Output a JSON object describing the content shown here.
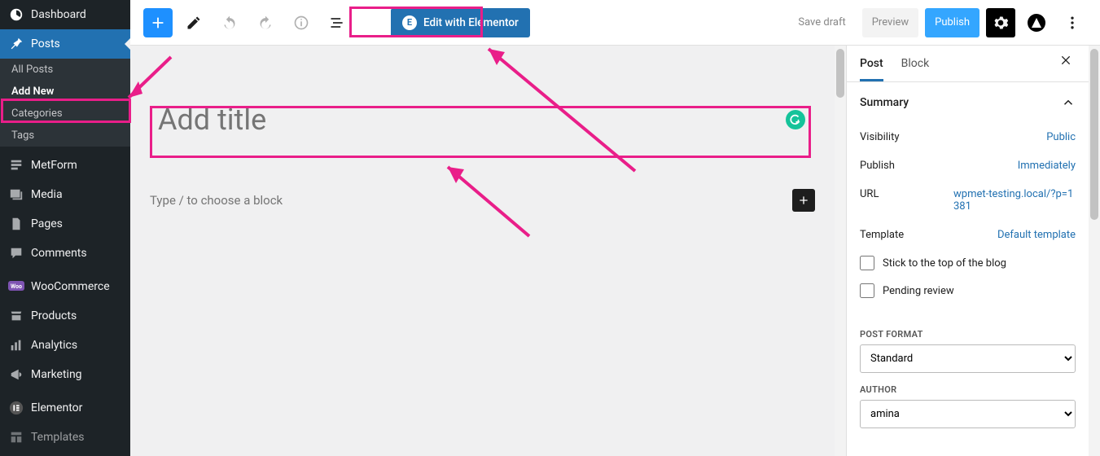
{
  "sidebar": {
    "dashboard": "Dashboard",
    "posts": "Posts",
    "posts_sub": [
      {
        "label": "All Posts"
      },
      {
        "label": "Add New"
      },
      {
        "label": "Categories"
      },
      {
        "label": "Tags"
      }
    ],
    "items": [
      {
        "label": "MetForm"
      },
      {
        "label": "Media"
      },
      {
        "label": "Pages"
      },
      {
        "label": "Comments"
      },
      {
        "label": "WooCommerce"
      },
      {
        "label": "Products"
      },
      {
        "label": "Analytics"
      },
      {
        "label": "Marketing"
      },
      {
        "label": "Elementor"
      },
      {
        "label": "Templates"
      }
    ]
  },
  "topbar": {
    "edit_elementor": "Edit with Elementor",
    "save_draft": "Save draft",
    "preview": "Preview",
    "publish": "Publish"
  },
  "editor": {
    "title_placeholder": "Add title",
    "block_prompt": "Type / to choose a block"
  },
  "panel": {
    "tabs": {
      "post": "Post",
      "block": "Block"
    },
    "section_summary": "Summary",
    "rows": {
      "visibility": {
        "label": "Visibility",
        "value": "Public"
      },
      "publish": {
        "label": "Publish",
        "value": "Immediately"
      },
      "url": {
        "label": "URL",
        "value": "wpmet-testing.local/?p=1381"
      },
      "template": {
        "label": "Template",
        "value": "Default template"
      }
    },
    "stick_top": "Stick to the top of the blog",
    "pending_review": "Pending review",
    "post_format_label": "POST FORMAT",
    "post_format_value": "Standard",
    "author_label": "AUTHOR",
    "author_value": "amina"
  }
}
